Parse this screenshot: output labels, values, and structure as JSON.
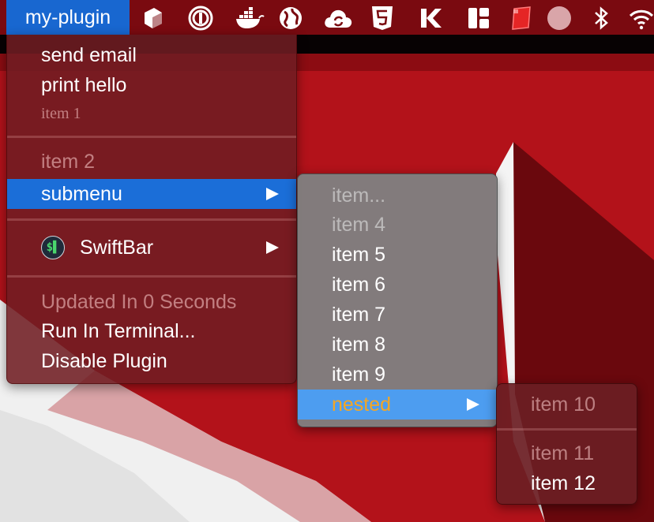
{
  "menubar": {
    "plugin_title": "my-plugin",
    "tray_icons": [
      "cube-icon",
      "power-app-icon",
      "docker-icon",
      "globe-icon",
      "cloud-sync-icon",
      "html5-icon",
      "k-app-icon",
      "grid-app-icon",
      "red-tile-icon",
      "circle-icon",
      "bluetooth-icon",
      "wifi-icon"
    ]
  },
  "main_menu": {
    "items": [
      {
        "label": "send email",
        "enabled": true
      },
      {
        "label": "print hello",
        "enabled": true
      },
      {
        "label": "item 1",
        "enabled": false
      },
      {
        "label": "item 2",
        "enabled": false
      },
      {
        "label": "submenu",
        "enabled": true,
        "selected": true,
        "has_submenu": true
      },
      {
        "label": "SwiftBar",
        "enabled": true,
        "has_submenu": true,
        "icon": "swiftbar-icon",
        "icon_text": "$▌"
      },
      {
        "label": "Updated In 0 Seconds",
        "enabled": false
      },
      {
        "label": "Run In Terminal...",
        "enabled": true
      },
      {
        "label": "Disable Plugin",
        "enabled": true
      }
    ]
  },
  "submenu": {
    "items": [
      {
        "label": "item...",
        "enabled": false
      },
      {
        "label": "item 4",
        "enabled": false
      },
      {
        "label": "item 5",
        "enabled": true
      },
      {
        "label": "item 6",
        "enabled": true
      },
      {
        "label": "item 7",
        "enabled": true
      },
      {
        "label": "item 8",
        "enabled": true
      },
      {
        "label": "item 9",
        "enabled": true
      },
      {
        "label": "nested",
        "enabled": true,
        "selected": true,
        "has_submenu": true,
        "color": "#f5a623"
      }
    ]
  },
  "nested_menu": {
    "items": [
      {
        "label": "item 10",
        "enabled": false
      },
      {
        "label": "item 11",
        "enabled": false
      },
      {
        "label": "item 12",
        "enabled": true
      }
    ]
  },
  "colors": {
    "menubar": "#7a0a10",
    "selection": "#1b6ed8",
    "nested_label": "#f5a623",
    "wallpaper_red": "#b3121a"
  }
}
